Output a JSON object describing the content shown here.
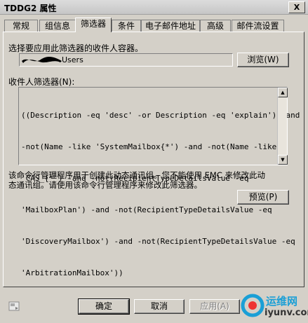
{
  "window": {
    "title": "TDDG2 属性",
    "close_glyph": "X"
  },
  "tabs": [
    {
      "label": "常规",
      "active": false
    },
    {
      "label": "组信息",
      "active": false
    },
    {
      "label": "筛选器",
      "active": true
    },
    {
      "label": "条件",
      "active": false
    },
    {
      "label": "电子邮件地址",
      "active": false
    },
    {
      "label": "高级",
      "active": false
    },
    {
      "label": "邮件流设置",
      "active": false
    }
  ],
  "container": {
    "label": "选择要应用此筛选器的收件人容器。",
    "value": "Users",
    "browse_label": "浏览(W)"
  },
  "filter": {
    "label": "收件人筛选器(N):",
    "lines": [
      "((Description -eq 'desc' -or Description -eq 'explain') -and",
      "-not(Name -like 'SystemMailbox{*') -and -not(Name -like",
      "'CAS_{*') -and -not(RecipientTypeDetailsValue -eq",
      "'MailboxPlan') -and -not(RecipientTypeDetailsValue -eq",
      "'DiscoveryMailbox') -and -not(RecipientTypeDetailsValue -eq",
      "'ArbitrationMailbox'))"
    ]
  },
  "note": {
    "line1": "该命令行管理程序用于创建此动态通讯组。您不能使用 EMC 来修改此动",
    "line2": "态通讯组。请使用该命令行管理程序来修改此筛选器。"
  },
  "preview_label": "预览(P)",
  "footer": {
    "ok": "确定",
    "cancel": "取消",
    "apply": "应用(A)"
  },
  "watermark": {
    "text1": "运维网",
    "text2": "iyunv.com",
    "accent": "#1a9fd6"
  }
}
